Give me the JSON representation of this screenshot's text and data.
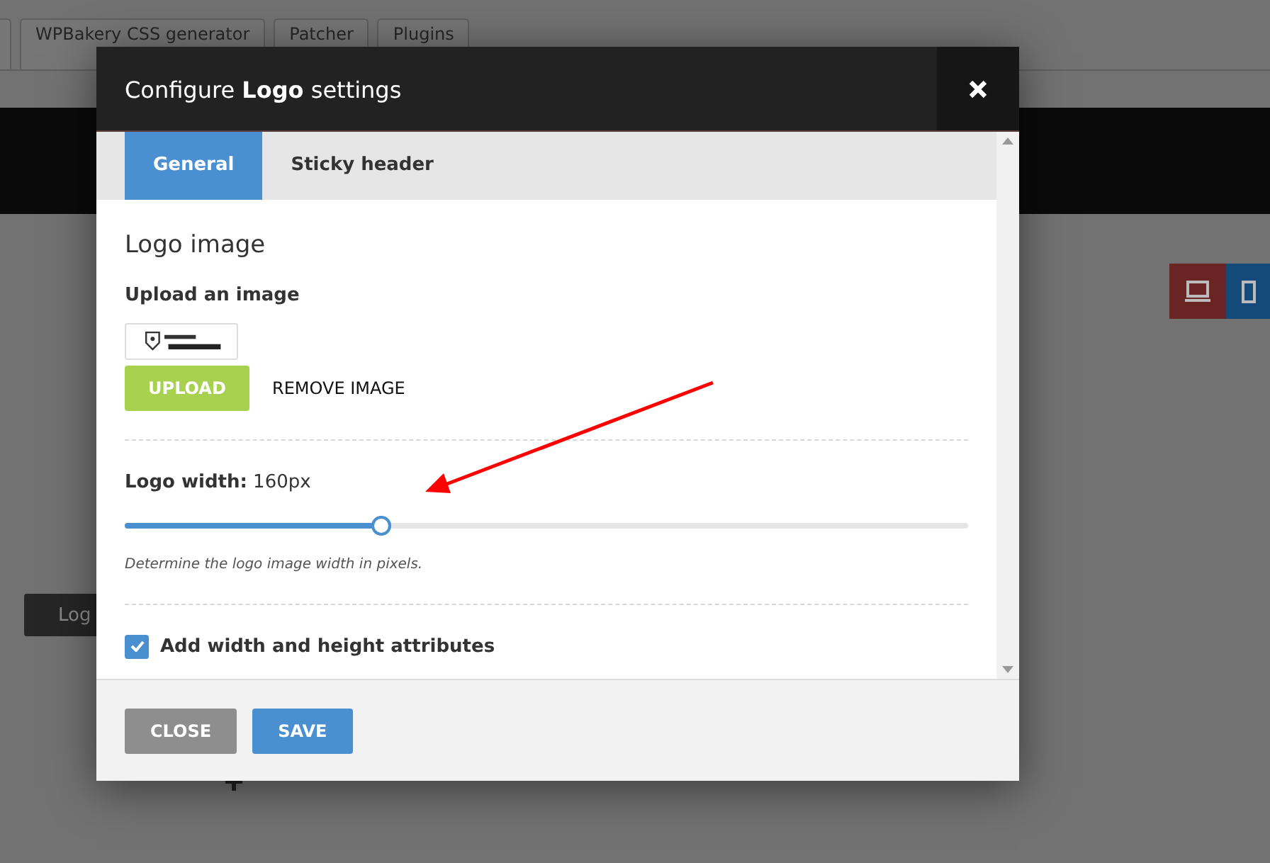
{
  "background_page": {
    "tabs": [
      {
        "label": "WPBakery CSS generator"
      },
      {
        "label": "Patcher"
      },
      {
        "label": "Plugins"
      }
    ],
    "logo_button": "Log"
  },
  "modal": {
    "title": "Configure **Logo** settings",
    "tabs": [
      {
        "label": "General",
        "selected": true
      },
      {
        "label": "Sticky header",
        "selected": false
      }
    ],
    "section_title": "Logo image",
    "upload_label": "Upload an image",
    "upload_button": "UPLOAD",
    "remove_button": "REMOVE IMAGE",
    "width_label": "**Logo width:** 160px",
    "width_slider": {
      "level": 0.305
    },
    "width_hint": "Determine the logo image width in pixels.",
    "checkbox": {
      "label": "Add width and height attributes",
      "checked": true
    },
    "footer_buttons": [
      {
        "label": "CLOSE",
        "kind": "secondary"
      },
      {
        "label": "SAVE",
        "kind": "primary"
      }
    ]
  }
}
